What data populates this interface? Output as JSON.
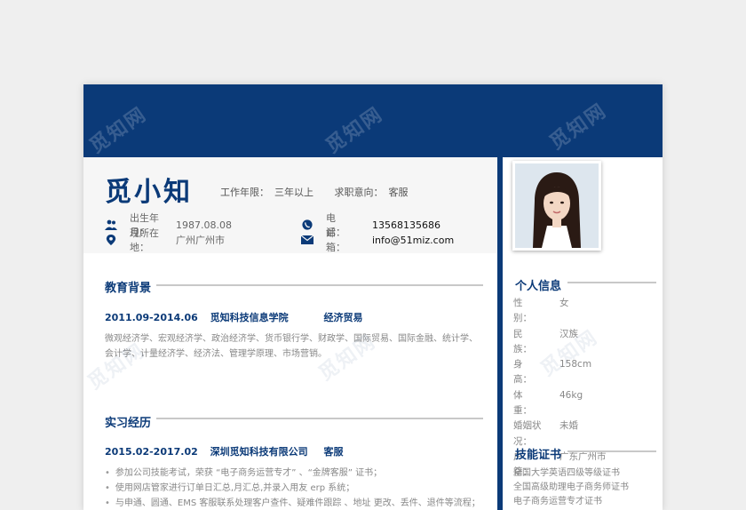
{
  "profile": {
    "name": "觅小知",
    "work_years_label": "工作年限：",
    "work_years_value": "三年以上",
    "intent_label": "求职意向：",
    "intent_value": "客服",
    "birth_label": "出生年月：",
    "birth_value": "1987.08.08",
    "location_label": "现所在地：",
    "location_value": "广州广州市",
    "phone_label": "电　　话：",
    "phone_value": "13568135686",
    "email_label": "邮　　箱：",
    "email_value": "info@51miz.com"
  },
  "education": {
    "title": "教育背景",
    "period": "2011.09-2014.06",
    "school": "觅知科技信息学院",
    "major": "经济贸易",
    "courses_line1": "微观经济学、宏观经济学、政治经济学、货币银行学、财政学、国际贸易、国际金融、统计学、",
    "courses_line2": "会计学、计量经济学、经济法、管理学原理、市场营销。"
  },
  "internship": {
    "title": "实习经历",
    "period": "2015.02-2017.02",
    "company": "深圳觅知科技有限公司",
    "role": "客服",
    "bullets": [
      "参加公司技能考试，荣获 “电子商务运营专才” 、“金牌客服” 证书；",
      "使用网店管家进行订单日汇总,月汇总,并录入用友 erp 系统；",
      "与申通、圆通、EMS 客服联系处理客户查件、疑难件跟踪 、地址 更改、丢件、退件等流程；"
    ]
  },
  "personal_info": {
    "title": "个人信息",
    "rows": [
      {
        "k": "性　　别：",
        "v": "女"
      },
      {
        "k": "民　　族：",
        "v": "汉族"
      },
      {
        "k": "身　　高：",
        "v": "158cm"
      },
      {
        "k": "体　　重：",
        "v": "46kg"
      },
      {
        "k": "婚姻状况：",
        "v": "未婚"
      },
      {
        "k": "户　　籍：",
        "v": "广东广州市"
      }
    ]
  },
  "skills": {
    "title": "技能证书",
    "items": [
      "全国大学英语四级等级证书",
      "全国高级助理电子商务师证书",
      "电子商务运营专才证书"
    ]
  },
  "watermark": "觅知网",
  "colors": {
    "primary": "#0b3a78",
    "background": "#efefef"
  }
}
